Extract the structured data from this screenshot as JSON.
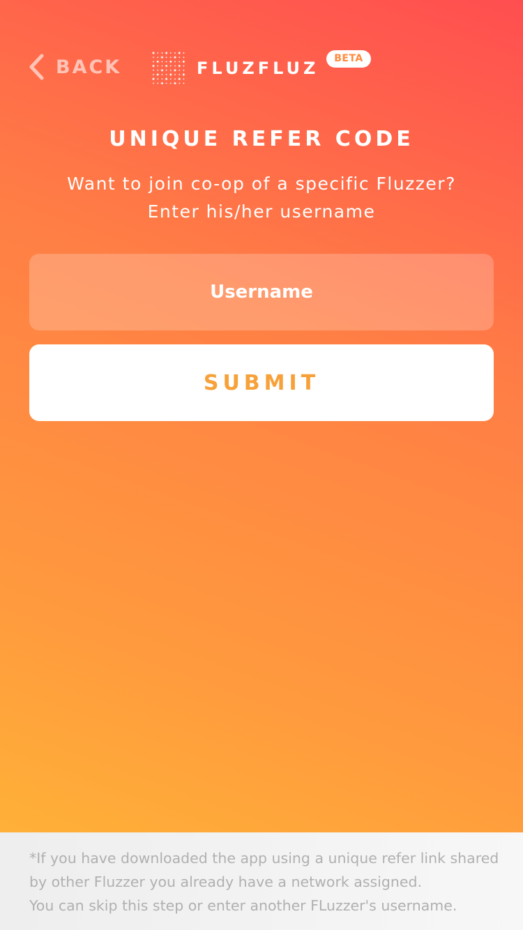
{
  "colors": {
    "gradient_top": "#ff4e50",
    "gradient_bottom": "#ffba35",
    "submit_text": "#f7a13a",
    "footer_text": "#b0b0b0"
  },
  "header": {
    "back_label": "BACK",
    "back_icon": "chevron-left-icon",
    "logo_text": "FLUZFLUZ",
    "logo_icon": "fluzfluz-star-grid-logo",
    "badge": "BETA"
  },
  "main": {
    "title": "UNIQUE REFER CODE",
    "subtitle_line1": "Want to join co-op of a specific Fluzzer?",
    "subtitle_line2": "Enter his/her username",
    "username": {
      "placeholder": "Username",
      "value": ""
    },
    "submit_label": "SUBMIT"
  },
  "footer": {
    "line1": "*If you have downloaded the app using a unique refer link shared",
    "line2": "by other Fluzzer you already have a network assigned.",
    "line3": "You can skip this step or enter another FLuzzer's username."
  }
}
